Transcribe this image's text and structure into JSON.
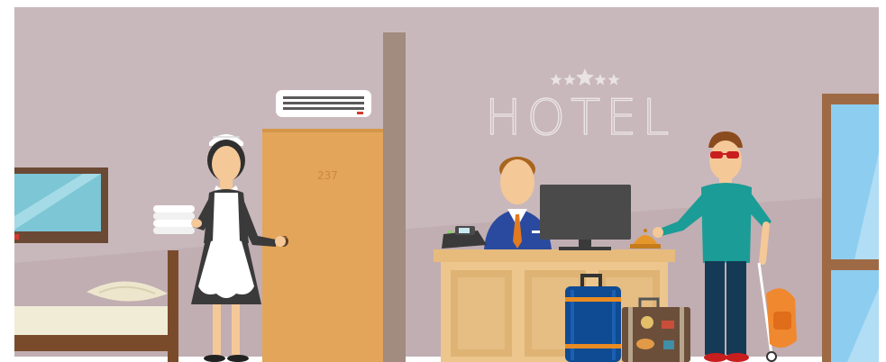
{
  "scene": {
    "sign_text": "HOTEL",
    "sign_star_count": 5,
    "room_number": "237"
  },
  "colors": {
    "wall": "#c9b8bb",
    "wall_lower": "#c0aeb2",
    "door": "#e3a55a",
    "pillar": "#a28b7f",
    "desk": "#ecc68d",
    "desk_panel": "#deb374",
    "floor": "#ffffff"
  }
}
